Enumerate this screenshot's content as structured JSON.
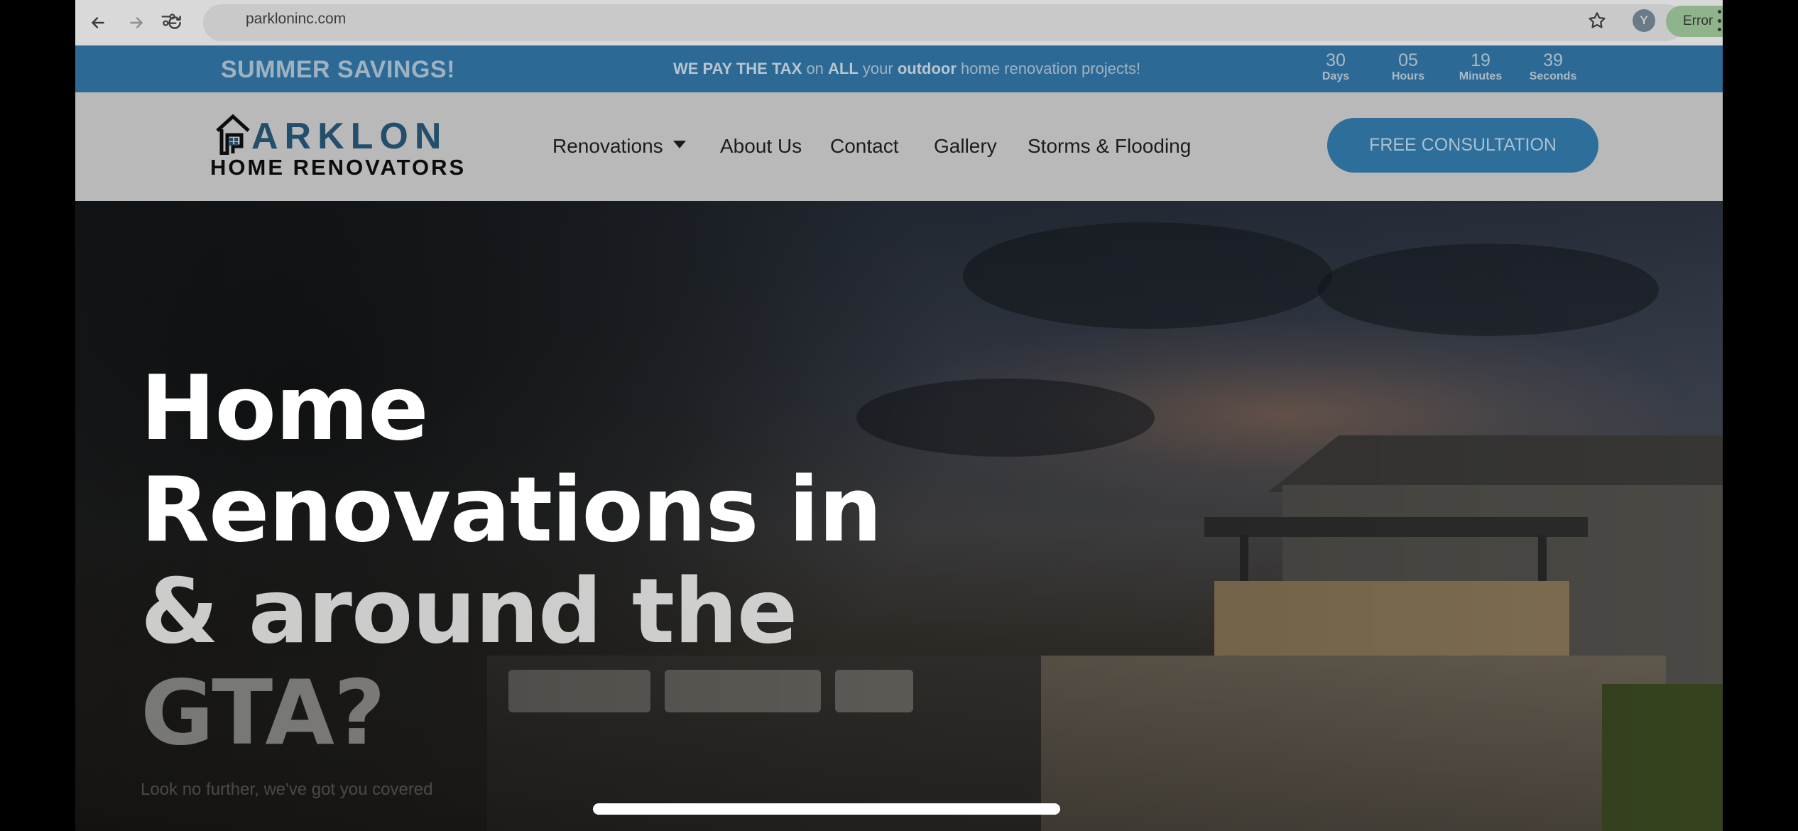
{
  "browser": {
    "url": "parkloninc.com",
    "profile_initial": "Y",
    "status_label": "Error"
  },
  "promo": {
    "headline": "SUMMER SAVINGS!",
    "text_parts": [
      "WE PAY THE TAX",
      " on ",
      "ALL",
      " your ",
      "outdoor",
      " home renovation projects!"
    ],
    "countdown": [
      {
        "value": "30",
        "label": "Days"
      },
      {
        "value": "05",
        "label": "Hours"
      },
      {
        "value": "19",
        "label": "Minutes"
      },
      {
        "value": "39",
        "label": "Seconds"
      }
    ]
  },
  "header": {
    "logo_word": "ARKLON",
    "logo_sub": "HOME RENOVATORS",
    "nav": [
      "Renovations",
      "About Us",
      "Contact",
      "Gallery",
      "Storms & Flooding"
    ],
    "cta": "FREE CONSULTATION"
  },
  "hero": {
    "title_lines": [
      "Home",
      "Renovations in",
      "& around the",
      "GTA?"
    ],
    "subtitle": "Look no further, we've got you covered"
  },
  "colors": {
    "promo_bg": "#2c6a95",
    "cta_bg": "#2e6e9a",
    "logo_blue": "#244f6c"
  },
  "icons": [
    "back-arrow-icon",
    "forward-arrow-icon",
    "reload-icon",
    "site-info-icon",
    "star-icon",
    "menu-dots-icon",
    "house-logo-icon",
    "caret-down-icon"
  ]
}
